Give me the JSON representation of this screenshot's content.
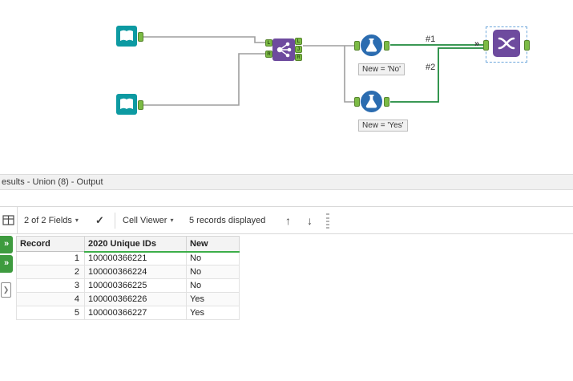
{
  "canvas": {
    "annotations": {
      "formula1": "New = 'No'",
      "formula2": "New = 'Yes'"
    },
    "connection_labels": {
      "first": "#1",
      "second": "#2"
    },
    "join_anchors": {
      "in_top": "L",
      "in_bottom": "R",
      "out_top": "L",
      "out_mid": "J",
      "out_bottom": "R"
    }
  },
  "results": {
    "title": "esults - Union (8) - Output",
    "toolbar": {
      "fields": "2 of 2 Fields",
      "cell_viewer": "Cell Viewer",
      "records": "5 records displayed"
    },
    "table": {
      "columns": [
        "Record",
        "2020 Unique IDs",
        "New"
      ],
      "rows": [
        [
          "1",
          "100000366221",
          "No"
        ],
        [
          "2",
          "100000366224",
          "No"
        ],
        [
          "3",
          "100000366225",
          "No"
        ],
        [
          "4",
          "100000366226",
          "Yes"
        ],
        [
          "5",
          "100000366227",
          "Yes"
        ]
      ]
    }
  },
  "icons": {
    "caret": "▾",
    "check": "✓",
    "up": "↑",
    "down": "↓",
    "anchor_chevrons": "»",
    "rail_chevrons": "»",
    "rail_chevron": "❯"
  },
  "colors": {
    "tool_teal": "#0D9AA2",
    "tool_purple": "#6E4B9E",
    "tool_blue": "#2B6CB0",
    "anchor_green": "#7CBB45",
    "wire_gray": "#9E9E9E",
    "wire_green": "#1E8A3C",
    "header_underline_green": "#3CAE49",
    "rail_badge_green": "#3E9B3F"
  }
}
